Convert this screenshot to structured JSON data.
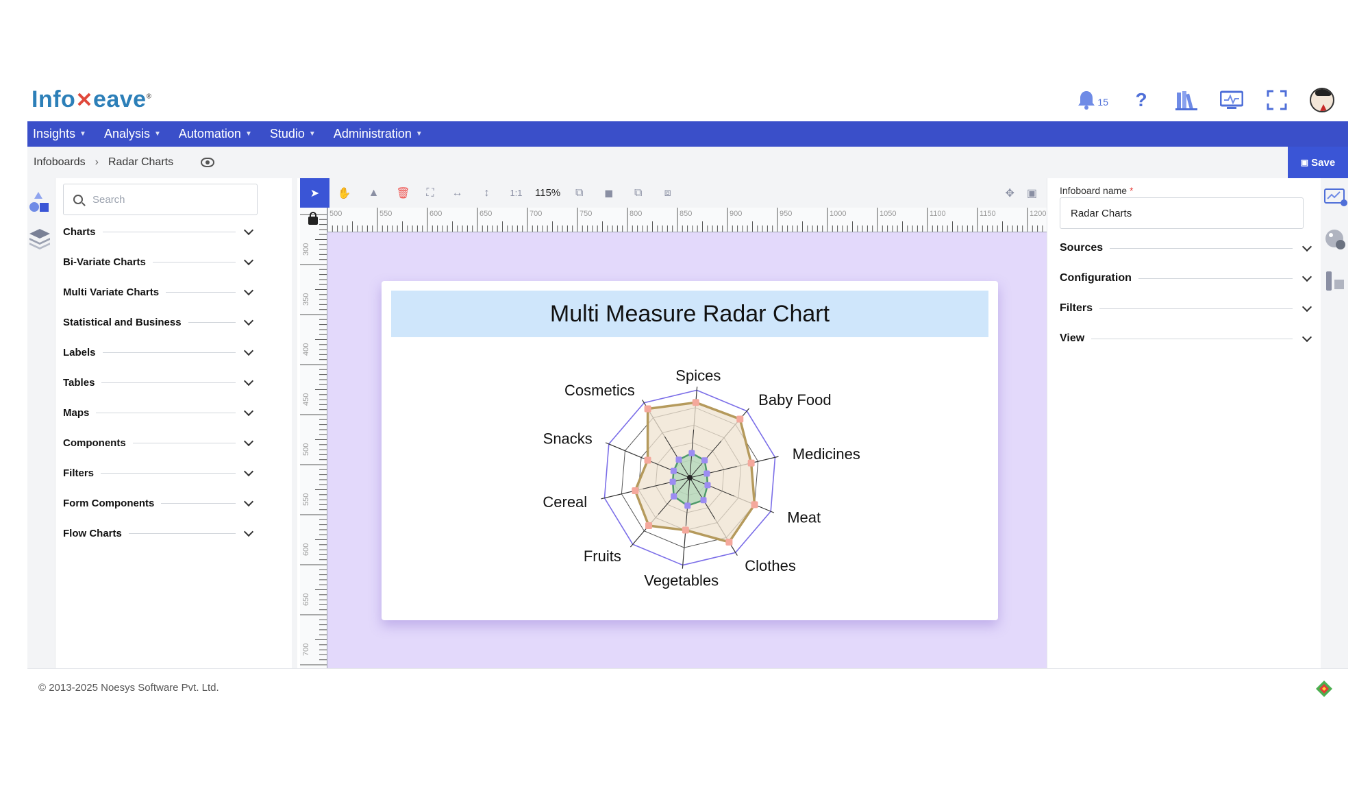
{
  "brand": {
    "logo_part1": "Info",
    "logo_part2": "eave"
  },
  "header": {
    "notification_count": "15"
  },
  "nav": {
    "items": [
      {
        "label": "Insights"
      },
      {
        "label": "Analysis"
      },
      {
        "label": "Automation"
      },
      {
        "label": "Studio"
      },
      {
        "label": "Administration"
      }
    ]
  },
  "breadcrumb": {
    "root": "Infoboards",
    "current": "Radar Charts"
  },
  "actions": {
    "save_label": "Save"
  },
  "widgets": {
    "search_placeholder": "Search",
    "categories": [
      {
        "label": "Charts"
      },
      {
        "label": "Bi-Variate Charts"
      },
      {
        "label": "Multi Variate Charts"
      },
      {
        "label": "Statistical and Business"
      },
      {
        "label": "Labels"
      },
      {
        "label": "Tables"
      },
      {
        "label": "Maps"
      },
      {
        "label": "Components"
      },
      {
        "label": "Filters"
      },
      {
        "label": "Form Components"
      },
      {
        "label": "Flow Charts"
      }
    ]
  },
  "toolbar": {
    "zoom": "115%",
    "ratio_label": "1:1"
  },
  "ruler": {
    "h_ticks": [
      "500",
      "550",
      "600",
      "650",
      "700",
      "750",
      "800",
      "850",
      "900",
      "950",
      "1000",
      "1050",
      "1100",
      "1150",
      "1200"
    ],
    "v_ticks": [
      "300",
      "350",
      "400",
      "450",
      "500",
      "550",
      "600",
      "650",
      "700"
    ]
  },
  "properties": {
    "name_label": "Infoboard name",
    "name_value": "Radar Charts",
    "sections": [
      {
        "label": "Sources"
      },
      {
        "label": "Configuration"
      },
      {
        "label": "Filters"
      },
      {
        "label": "View"
      }
    ]
  },
  "footer": {
    "copyright": "© 2013-2025 Noesys Software Pvt. Ltd."
  },
  "colors": {
    "nav_bg": "#3a4fc9",
    "accent": "#3a55d6",
    "canvas_bg": "#e3d9fb",
    "series1_line": "#b59a5c",
    "series1_fill": "#efe3d0",
    "series1_point": "#f4a89c",
    "series2_line": "#4e9a6a",
    "series2_point": "#9c8cf2",
    "grid_ring": "#7b6ee8"
  },
  "chart_data": {
    "type": "radar",
    "title": "Multi Measure Radar Chart",
    "categories": [
      "Spices",
      "Baby Food",
      "Medicines",
      "Meat",
      "Clothes",
      "Vegetables",
      "Fruits",
      "Cereal",
      "Snacks",
      "Cosmetics"
    ],
    "rlim": [
      0,
      5
    ],
    "rings": 5,
    "grid": true,
    "series": [
      {
        "values": [
          4.3,
          4.4,
          3.6,
          4.0,
          4.3,
          3.0,
          3.6,
          3.2,
          2.6,
          4.6
        ]
      },
      {
        "values": [
          1.4,
          1.3,
          1.0,
          1.1,
          1.5,
          1.6,
          1.4,
          1.0,
          1.0,
          1.2
        ]
      }
    ]
  }
}
